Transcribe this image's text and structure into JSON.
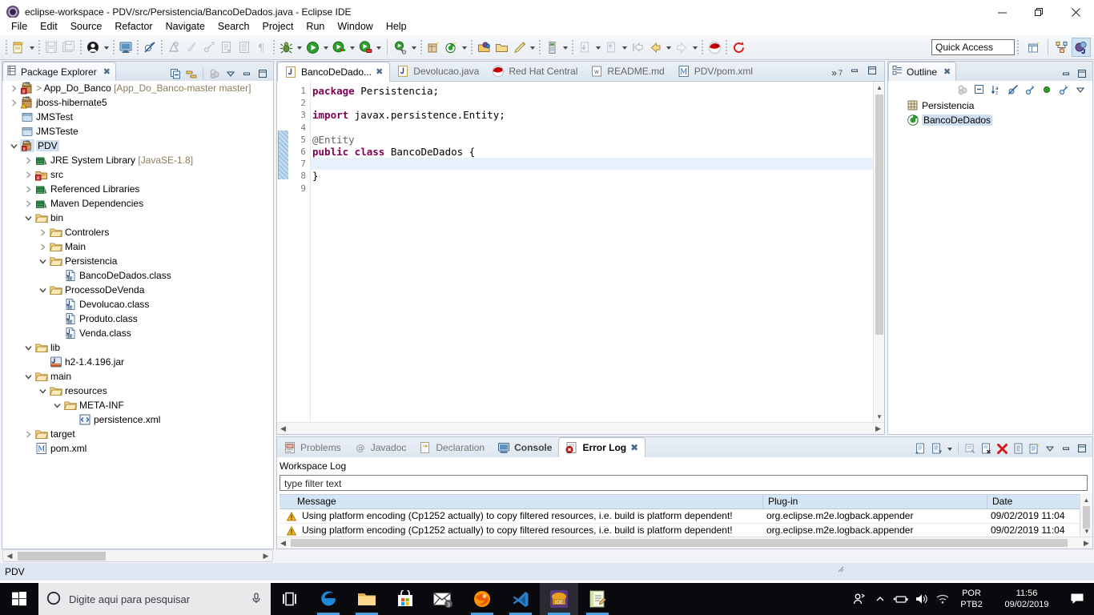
{
  "window": {
    "title": "eclipse-workspace - PDV/src/Persistencia/BancoDeDados.java - Eclipse IDE",
    "minimize_label": "Minimize",
    "maximize_label": "Restore",
    "close_label": "Close"
  },
  "menubar": {
    "items": [
      "File",
      "Edit",
      "Source",
      "Refactor",
      "Navigate",
      "Search",
      "Project",
      "Run",
      "Window",
      "Help"
    ]
  },
  "toolbar": {
    "quick_access_placeholder": "Quick Access",
    "quick_access_value": "Quick Access",
    "buttons": [
      "new-wizard-icon",
      "save-icon",
      "save-all-icon",
      "user-icon",
      "toggle-console-icon",
      "skip-breakpoints-icon",
      "build-icon",
      "brush-icon",
      "link-icon",
      "export-icon",
      "properties-icon",
      "paragraph-icon",
      "debug-icon",
      "run-icon",
      "coverage-icon",
      "run-external-icon",
      "run-server-icon",
      "new-package-icon",
      "new-java-class-icon",
      "open-type-icon",
      "open-task-icon",
      "pencil-icon",
      "memory-icon",
      "previous-annotation-icon",
      "next-annotation-icon",
      "last-edit-icon",
      "back-icon",
      "forward-icon",
      "red-hat-icon",
      "refresh-icon"
    ],
    "perspective_buttons": [
      "open-perspective-icon",
      "java-ee-perspective-icon",
      "java-perspective-icon"
    ]
  },
  "package_explorer": {
    "tab_label": "Package Explorer",
    "tools": [
      "collapse-all-icon",
      "link-with-editor-icon",
      "view-menu-icon",
      "minimize-icon",
      "maximize-icon"
    ],
    "tree": [
      {
        "label": "App_Do_Banco",
        "suffix": " [App_Do_Banco-master master]",
        "prefix": "> ",
        "indent": 0,
        "twisty": "collapsed",
        "icon": "java-project-error-icon"
      },
      {
        "label": "jboss-hibernate5",
        "suffix": "",
        "prefix": "",
        "indent": 0,
        "twisty": "collapsed",
        "icon": "java-project-warning-icon"
      },
      {
        "label": "JMSTest",
        "suffix": "",
        "prefix": "",
        "indent": 0,
        "twisty": "none",
        "icon": "closed-project-icon"
      },
      {
        "label": "JMSTeste",
        "suffix": "",
        "prefix": "",
        "indent": 0,
        "twisty": "none",
        "icon": "closed-project-icon"
      },
      {
        "label": "PDV",
        "suffix": "",
        "prefix": "",
        "indent": 0,
        "twisty": "expanded",
        "icon": "java-project-error-icon",
        "selected": true
      },
      {
        "label": "JRE System Library",
        "suffix": " [JavaSE-1.8]",
        "prefix": "",
        "indent": 1,
        "twisty": "collapsed",
        "icon": "library-icon"
      },
      {
        "label": "src",
        "suffix": "",
        "prefix": "",
        "indent": 1,
        "twisty": "collapsed",
        "icon": "source-folder-error-icon"
      },
      {
        "label": "Referenced Libraries",
        "suffix": "",
        "prefix": "",
        "indent": 1,
        "twisty": "collapsed",
        "icon": "library-icon"
      },
      {
        "label": "Maven Dependencies",
        "suffix": "",
        "prefix": "",
        "indent": 1,
        "twisty": "collapsed",
        "icon": "library-icon"
      },
      {
        "label": "bin",
        "suffix": "",
        "prefix": "",
        "indent": 1,
        "twisty": "expanded",
        "icon": "folder-icon"
      },
      {
        "label": "Controlers",
        "suffix": "",
        "prefix": "",
        "indent": 2,
        "twisty": "collapsed",
        "icon": "folder-icon"
      },
      {
        "label": "Main",
        "suffix": "",
        "prefix": "",
        "indent": 2,
        "twisty": "collapsed",
        "icon": "folder-icon"
      },
      {
        "label": "Persistencia",
        "suffix": "",
        "prefix": "",
        "indent": 2,
        "twisty": "expanded",
        "icon": "folder-icon"
      },
      {
        "label": "BancoDeDados.class",
        "suffix": "",
        "prefix": "",
        "indent": 3,
        "twisty": "none",
        "icon": "class-file-icon"
      },
      {
        "label": "ProcessoDeVenda",
        "suffix": "",
        "prefix": "",
        "indent": 2,
        "twisty": "expanded",
        "icon": "folder-icon"
      },
      {
        "label": "Devolucao.class",
        "suffix": "",
        "prefix": "",
        "indent": 3,
        "twisty": "none",
        "icon": "class-file-icon"
      },
      {
        "label": "Produto.class",
        "suffix": "",
        "prefix": "",
        "indent": 3,
        "twisty": "none",
        "icon": "class-file-icon"
      },
      {
        "label": "Venda.class",
        "suffix": "",
        "prefix": "",
        "indent": 3,
        "twisty": "none",
        "icon": "class-file-icon"
      },
      {
        "label": "lib",
        "suffix": "",
        "prefix": "",
        "indent": 1,
        "twisty": "expanded",
        "icon": "folder-icon"
      },
      {
        "label": "h2-1.4.196.jar",
        "suffix": "",
        "prefix": "",
        "indent": 2,
        "twisty": "none",
        "icon": "jar-icon"
      },
      {
        "label": "main",
        "suffix": "",
        "prefix": "",
        "indent": 1,
        "twisty": "expanded",
        "icon": "folder-icon"
      },
      {
        "label": "resources",
        "suffix": "",
        "prefix": "",
        "indent": 2,
        "twisty": "expanded",
        "icon": "folder-icon"
      },
      {
        "label": "META-INF",
        "suffix": "",
        "prefix": "",
        "indent": 3,
        "twisty": "expanded",
        "icon": "folder-icon"
      },
      {
        "label": "persistence.xml",
        "suffix": "",
        "prefix": "",
        "indent": 4,
        "twisty": "none",
        "icon": "xml-file-icon"
      },
      {
        "label": "target",
        "suffix": "",
        "prefix": "",
        "indent": 1,
        "twisty": "collapsed",
        "icon": "folder-icon"
      },
      {
        "label": "pom.xml",
        "suffix": "",
        "prefix": "",
        "indent": 1,
        "twisty": "none",
        "icon": "maven-pom-icon"
      }
    ]
  },
  "editor": {
    "tabs": [
      {
        "label": "BancoDeDado...",
        "icon": "java-file-icon",
        "active": true,
        "closeable": true
      },
      {
        "label": "Devolucao.java",
        "icon": "java-file-icon",
        "active": false,
        "closeable": false
      },
      {
        "label": "Red Hat Central",
        "icon": "red-hat-icon",
        "active": false,
        "closeable": false
      },
      {
        "label": "README.md",
        "icon": "markdown-file-icon",
        "active": false,
        "closeable": false
      },
      {
        "label": "PDV/pom.xml",
        "icon": "maven-pom-icon",
        "active": false,
        "closeable": false
      }
    ],
    "overflow_count": "7",
    "overflow_label": "»",
    "line_numbers": [
      "1",
      "2",
      "3",
      "4",
      "5",
      "6",
      "7",
      "8",
      "9"
    ],
    "lines": [
      {
        "n": 1,
        "segments": [
          {
            "t": "package",
            "c": "kw"
          },
          {
            "t": " Persistencia;",
            "c": ""
          }
        ]
      },
      {
        "n": 2,
        "segments": [
          {
            "t": "",
            "c": ""
          }
        ]
      },
      {
        "n": 3,
        "segments": [
          {
            "t": "import",
            "c": "kw"
          },
          {
            "t": " javax.persistence.Entity;",
            "c": ""
          }
        ]
      },
      {
        "n": 4,
        "segments": [
          {
            "t": "",
            "c": ""
          }
        ]
      },
      {
        "n": 5,
        "segments": [
          {
            "t": "@Entity",
            "c": "ann"
          }
        ]
      },
      {
        "n": 6,
        "segments": [
          {
            "t": "public class",
            "c": "kw"
          },
          {
            "t": " BancoDeDados {",
            "c": ""
          }
        ]
      },
      {
        "n": 7,
        "segments": [
          {
            "t": "",
            "c": ""
          }
        ],
        "current": true
      },
      {
        "n": 8,
        "segments": [
          {
            "t": "}",
            "c": ""
          }
        ]
      },
      {
        "n": 9,
        "segments": [
          {
            "t": "",
            "c": ""
          }
        ]
      }
    ]
  },
  "outline": {
    "tab_label": "Outline",
    "tools": [
      "sort-members-icon",
      "collapse-all-icon",
      "sort-alpha-icon",
      "hide-fields-icon",
      "hide-static-icon",
      "hide-non-public-icon",
      "hide-local-types-icon",
      "view-menu-icon"
    ],
    "items": [
      {
        "label": "Persistencia",
        "icon": "package-icon",
        "indent": 0,
        "selected": false
      },
      {
        "label": "BancoDeDados",
        "icon": "class-icon",
        "indent": 0,
        "selected": true
      }
    ]
  },
  "bottom_panel": {
    "tabs": [
      {
        "label": "Problems",
        "icon": "problems-icon",
        "active": false
      },
      {
        "label": "Javadoc",
        "icon": "javadoc-icon",
        "active": false
      },
      {
        "label": "Declaration",
        "icon": "declaration-icon",
        "active": false
      },
      {
        "label": "Console",
        "icon": "console-icon",
        "active": false
      },
      {
        "label": "Error Log",
        "icon": "error-log-icon",
        "active": true
      }
    ],
    "tools": [
      "export-log-icon",
      "import-log-icon",
      "view-menu-arrow-icon",
      "open-log-icon",
      "clear-log-viewer-icon",
      "delete-log-icon",
      "open-log-file-icon",
      "restore-log-icon",
      "view-menu-icon",
      "minimize-icon",
      "maximize-icon"
    ],
    "log_title": "Workspace Log",
    "filter_value": "type filter text",
    "columns": [
      "Message",
      "Plug-in",
      "Date"
    ],
    "rows": [
      {
        "severity": "warning",
        "message": "Using platform encoding (Cp1252 actually) to copy filtered resources, i.e. build is platform dependent!",
        "plugin": "org.eclipse.m2e.logback.appender",
        "date": "09/02/2019 11:04"
      },
      {
        "severity": "warning",
        "message": "Using platform encoding (Cp1252 actually) to copy filtered resources, i.e. build is platform dependent!",
        "plugin": "org.eclipse.m2e.logback.appender",
        "date": "09/02/2019 11:04"
      }
    ]
  },
  "statusbar": {
    "text": "PDV"
  },
  "taskbar": {
    "search_placeholder": "Digite aqui para pesquisar",
    "start_label": "Start",
    "mic_icon": "microphone-icon",
    "taskview_icon": "task-view-icon",
    "apps": [
      {
        "name": "edge-icon",
        "running": true,
        "active": false
      },
      {
        "name": "file-explorer-icon",
        "running": true,
        "active": false
      },
      {
        "name": "microsoft-store-icon",
        "running": false,
        "active": false
      },
      {
        "name": "mail-icon",
        "running": false,
        "active": false,
        "badge": "3"
      },
      {
        "name": "firefox-icon",
        "running": true,
        "active": false
      },
      {
        "name": "vs-code-icon",
        "running": true,
        "active": false
      },
      {
        "name": "eclipse-icon",
        "running": true,
        "active": true
      },
      {
        "name": "notepad-icon",
        "running": true,
        "active": false
      }
    ],
    "tray": {
      "people_icon": "people-icon",
      "chevron_icon": "show-hidden-icons-icon",
      "battery_icon": "battery-icon",
      "volume_icon": "volume-icon",
      "network_icon": "wifi-icon",
      "lang_line1": "POR",
      "lang_line2": "PTB2",
      "time": "11:56",
      "date": "09/02/2019",
      "action_center_icon": "action-center-icon"
    }
  },
  "colors": {
    "accent_blue": "#cfe0f2",
    "keyword_purple": "#7f0055",
    "header_blue": "#d4e5f5",
    "status_bg": "#dfe6f2",
    "taskbar_bg": "#0a0a0e",
    "warning_amber": "#f0ad1e"
  }
}
